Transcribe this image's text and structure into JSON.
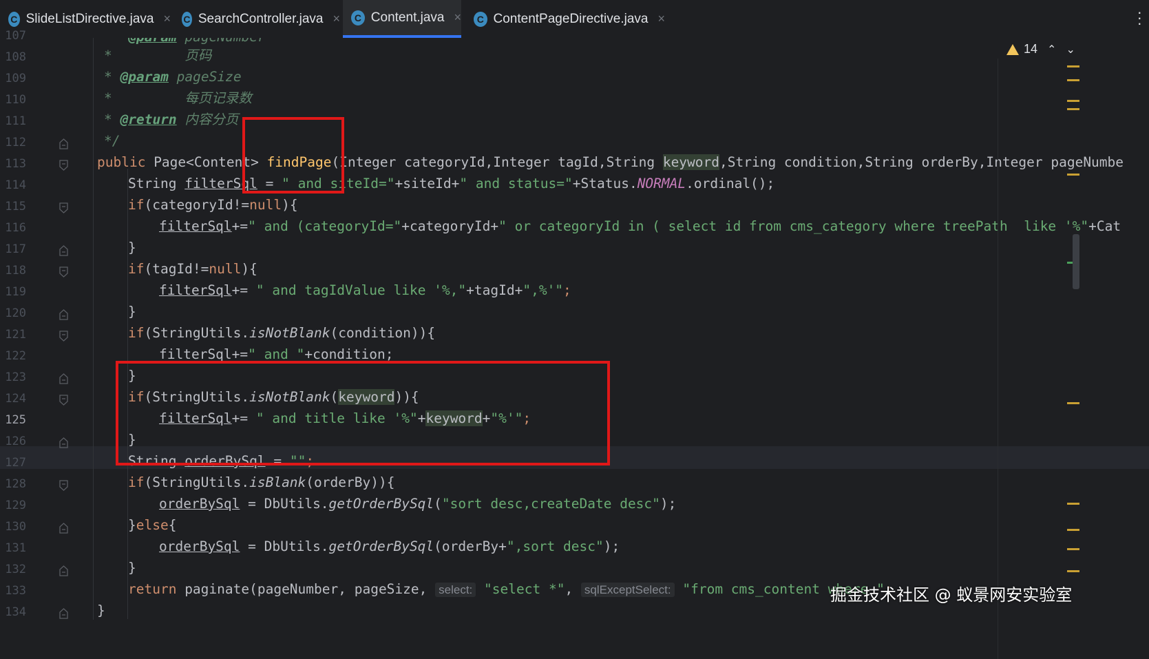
{
  "tabs": [
    {
      "label": "SlideListDirective.java",
      "icon": "class-c-icon",
      "active": false
    },
    {
      "label": "SearchController.java",
      "icon": "class-c-icon",
      "active": false
    },
    {
      "label": "Content.java",
      "icon": "class-c-icon",
      "active": true
    },
    {
      "label": "ContentPageDirective.java",
      "icon": "class-c-icon",
      "active": false
    }
  ],
  "tab_icon_letter": "C",
  "tab_close_glyph": "×",
  "menu_icon": "more-vertical-icon",
  "warnings": {
    "count": "14",
    "icon": "warning-triangle-icon",
    "up": "⌃",
    "down": "⌄"
  },
  "line_numbers": [
    "107",
    "108",
    "109",
    "110",
    "111",
    "112",
    "113",
    "114",
    "115",
    "116",
    "117",
    "118",
    "119",
    "120",
    "121",
    "122",
    "123",
    "124",
    "125",
    "126",
    "127",
    "128",
    "129",
    "130",
    "131",
    "132",
    "133",
    "134"
  ],
  "current_line": "125",
  "code": {
    "l108_star": "*",
    "l108_text": "页码",
    "l109_star": "* ",
    "l109_tag": "@param",
    "l109_text": " pageSize",
    "l110_star": "*",
    "l110_text": "每页记录数",
    "l111_star": "* ",
    "l111_tag": "@return",
    "l111_text": " 内容分页",
    "l112_text": "*/",
    "l113": {
      "public": "public ",
      "type": "Page<Content> ",
      "name": "findPage",
      "params_a": "(Integer categoryId,Integer tagId,String ",
      "keyword": "keyword",
      "params_b": ",String condition,String orderBy,Integer pageNumbe"
    },
    "l114": {
      "a": "String ",
      "var": "filterSql",
      "b": " = ",
      "s1": "\" and siteId=\"",
      "c": "+siteId+",
      "s2": "\" and status=\"",
      "d": "+Status.",
      "const": "NORMAL",
      "e": ".ordinal();"
    },
    "l115": {
      "if": "if",
      "a": "(categoryId!=",
      "null": "null",
      "b": "){"
    },
    "l116": {
      "var": "filterSql",
      "a": "+=",
      "s1": "\" and (categoryId=\"",
      "b": "+categoryId+",
      "s2": "\" or categoryId in ( select id from cms_category where treePath  like '%\"",
      "c": "+Cat"
    },
    "l117": "}",
    "l118": {
      "if": "if",
      "a": "(tagId!=",
      "null": "null",
      "b": "){"
    },
    "l119": {
      "var": "filterSql",
      "a": "+= ",
      "s1": "\" and tagIdValue like '%,\"",
      "b": "+tagId+",
      "s2": "\",%'\"",
      "c": ";"
    },
    "l120": "}",
    "l121": {
      "if": "if",
      "a": "(StringUtils.",
      "m": "isNotBlank",
      "b": "(condition)){"
    },
    "l122": {
      "var": "filterSql",
      "a": "+=",
      "s1": "\" and \"",
      "b": "+condition;"
    },
    "l123": "}",
    "l124": {
      "if": "if",
      "a": "(StringUtils.",
      "m": "isNotBlank",
      "b": "(",
      "kw": "keyword",
      "c": ")){"
    },
    "l125": {
      "var": "filterSql",
      "a": "+= ",
      "s1": "\" and title like '%\"",
      "b": "+",
      "kw": "keyword",
      "c": "+",
      "s2": "\"%'\"",
      "d": ";"
    },
    "l126": "}",
    "l127": {
      "a": "String ",
      "var": "orderBySql",
      "b": " = ",
      "s": "\"\"",
      "c": ";"
    },
    "l128": {
      "if": "if",
      "a": "(StringUtils.",
      "m": "isBlank",
      "b": "(orderBy)){"
    },
    "l129": {
      "var": "orderBySql",
      "a": " = DbUtils.",
      "m": "getOrderBySql",
      "b": "(",
      "s": "\"sort desc,createDate desc\"",
      "c": ");"
    },
    "l130": {
      "a": "}",
      "else": "else",
      "b": "{"
    },
    "l131": {
      "var": "orderBySql",
      "a": " = DbUtils.",
      "m": "getOrderBySql",
      "b": "(orderBy+",
      "s": "\",sort desc\"",
      "c": ");"
    },
    "l132": "}",
    "l133": {
      "return": "return ",
      "a": "paginate(pageNumber, pageSize, ",
      "hint1": "select:",
      "s1": "\"select *\"",
      "b": ", ",
      "hint2": "sqlExceptSelect:",
      "s2": "\"from cms_content where \"",
      "c": ";"
    },
    "l134": "}"
  },
  "watermark": "掘金技术社区 @ 蚁景网安实验室",
  "colors": {
    "background": "#1e1f22",
    "keyword": "#cf8e6d",
    "string": "#6aab73",
    "method_decl": "#ffc66d",
    "comment": "#5f826b",
    "highlight_box": "#e01818",
    "tab_active_underline": "#3574f0"
  }
}
